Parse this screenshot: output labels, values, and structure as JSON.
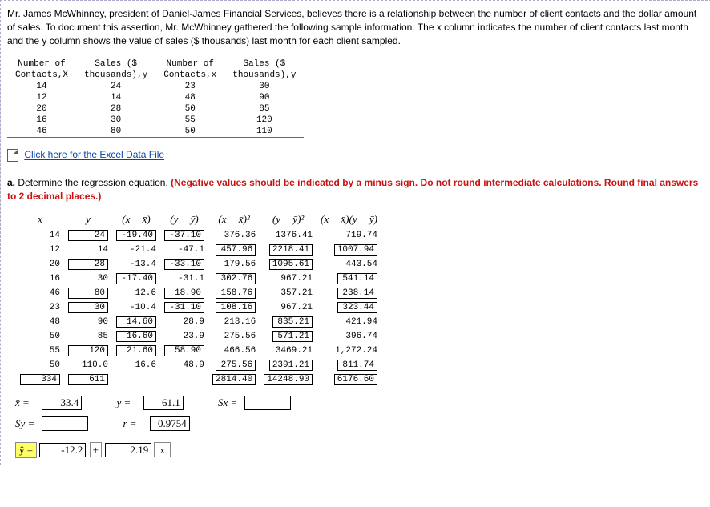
{
  "intro": "Mr. James McWhinney, president of Daniel-James Financial Services, believes there is a relationship between the number of client contacts and the dollar amount of sales. To document this assertion, Mr. McWhinney gathered the following sample information. The x column indicates the number of client contacts last month and the y column shows the value of sales ($ thousands) last month for each client sampled.",
  "table1": {
    "h1": "Number of",
    "h2": "Sales ($",
    "h3": "Number of",
    "h4": "Sales ($",
    "s1": "Contacts,X",
    "s2": "thousands),y",
    "s3": "Contacts,x",
    "s4": "thousands),y",
    "rows": [
      {
        "c1": "14",
        "c2": "24",
        "c3": "23",
        "c4": "30"
      },
      {
        "c1": "12",
        "c2": "14",
        "c3": "48",
        "c4": "90"
      },
      {
        "c1": "20",
        "c2": "28",
        "c3": "50",
        "c4": "85"
      },
      {
        "c1": "16",
        "c2": "30",
        "c3": "55",
        "c4": "120"
      },
      {
        "c1": "46",
        "c2": "80",
        "c3": "50",
        "c4": "110"
      }
    ]
  },
  "excel_link": "Click here for the Excel Data File",
  "question": {
    "prefix": "a.",
    "text": "Determine the regression equation. ",
    "red": "(Negative values should be indicated by a minus sign. Do not round intermediate calculations. Round final answers to 2 decimal places.)"
  },
  "headers": {
    "x": "x",
    "y": "y",
    "xd": "(x − x̄)",
    "yd": "(y − ȳ)",
    "xd2": "(x − x̄)²",
    "yd2": "(y − ȳ)²",
    "xy": "(x − x̄)(y − ȳ)"
  },
  "rows": [
    {
      "x": "14",
      "y": "24",
      "ybox": true,
      "xd": "-19.40",
      "xdbox": true,
      "yd": "-37.10",
      "ydbox": true,
      "xd2": "376.36",
      "xd2box": false,
      "yd2": "1376.41",
      "yd2box": false,
      "xy": "719.74",
      "xybox": false
    },
    {
      "x": "12",
      "y": "14",
      "ybox": false,
      "xd": "-21.4",
      "xdbox": false,
      "yd": "-47.1",
      "ydbox": false,
      "xd2": "457.96",
      "xd2box": true,
      "yd2": "2218.41",
      "yd2box": true,
      "xy": "1007.94",
      "xybox": true
    },
    {
      "x": "20",
      "y": "28",
      "ybox": true,
      "xd": "-13.4",
      "xdbox": false,
      "yd": "-33.10",
      "ydbox": true,
      "xd2": "179.56",
      "xd2box": false,
      "yd2": "1095.61",
      "yd2box": true,
      "xy": "443.54",
      "xybox": false
    },
    {
      "x": "16",
      "y": "30",
      "ybox": false,
      "xd": "-17.40",
      "xdbox": true,
      "yd": "-31.1",
      "ydbox": false,
      "xd2": "302.76",
      "xd2box": true,
      "yd2": "967.21",
      "yd2box": false,
      "xy": "541.14",
      "xybox": true
    },
    {
      "x": "46",
      "y": "80",
      "ybox": true,
      "xd": "12.6",
      "xdbox": false,
      "yd": "18.90",
      "ydbox": true,
      "xd2": "158.76",
      "xd2box": true,
      "yd2": "357.21",
      "yd2box": false,
      "xy": "238.14",
      "xybox": true
    },
    {
      "x": "23",
      "y": "30",
      "ybox": true,
      "xd": "-10.4",
      "xdbox": false,
      "yd": "-31.10",
      "ydbox": true,
      "xd2": "108.16",
      "xd2box": true,
      "yd2": "967.21",
      "yd2box": false,
      "xy": "323.44",
      "xybox": true
    },
    {
      "x": "48",
      "y": "90",
      "ybox": false,
      "xd": "14.60",
      "xdbox": true,
      "yd": "28.9",
      "ydbox": false,
      "xd2": "213.16",
      "xd2box": false,
      "yd2": "835.21",
      "yd2box": true,
      "xy": "421.94",
      "xybox": false
    },
    {
      "x": "50",
      "y": "85",
      "ybox": false,
      "xd": "16.60",
      "xdbox": true,
      "yd": "23.9",
      "ydbox": false,
      "xd2": "275.56",
      "xd2box": false,
      "yd2": "571.21",
      "yd2box": true,
      "xy": "396.74",
      "xybox": false
    },
    {
      "x": "55",
      "y": "120",
      "ybox": true,
      "xd": "21.60",
      "xdbox": true,
      "yd": "58.90",
      "ydbox": true,
      "xd2": "466.56",
      "xd2box": false,
      "yd2": "3469.21",
      "yd2box": false,
      "xy": "1,272.24",
      "xybox": false
    },
    {
      "x": "50",
      "y": "110.0",
      "ybox": false,
      "xd": "16.6",
      "xdbox": false,
      "yd": "48.9",
      "ydbox": false,
      "xd2": "275.56",
      "xd2box": true,
      "yd2": "2391.21",
      "yd2box": true,
      "xy": "811.74",
      "xybox": true
    }
  ],
  "totals": {
    "x": "334",
    "y": "611",
    "xd2": "2814.40",
    "yd2": "14248.90",
    "xy": "6176.60"
  },
  "summary": {
    "xbar_label": "x̄ =",
    "xbar": "33.4",
    "ybar_label": "ȳ =",
    "ybar": "61.1",
    "sx_label": "Sx =",
    "sy_label": "Sy =",
    "r_label": "r =",
    "r": "0.9754",
    "yhat_label": "ŷ =",
    "a": "-12.2",
    "plus": "+",
    "b": "2.19",
    "x": "x"
  }
}
